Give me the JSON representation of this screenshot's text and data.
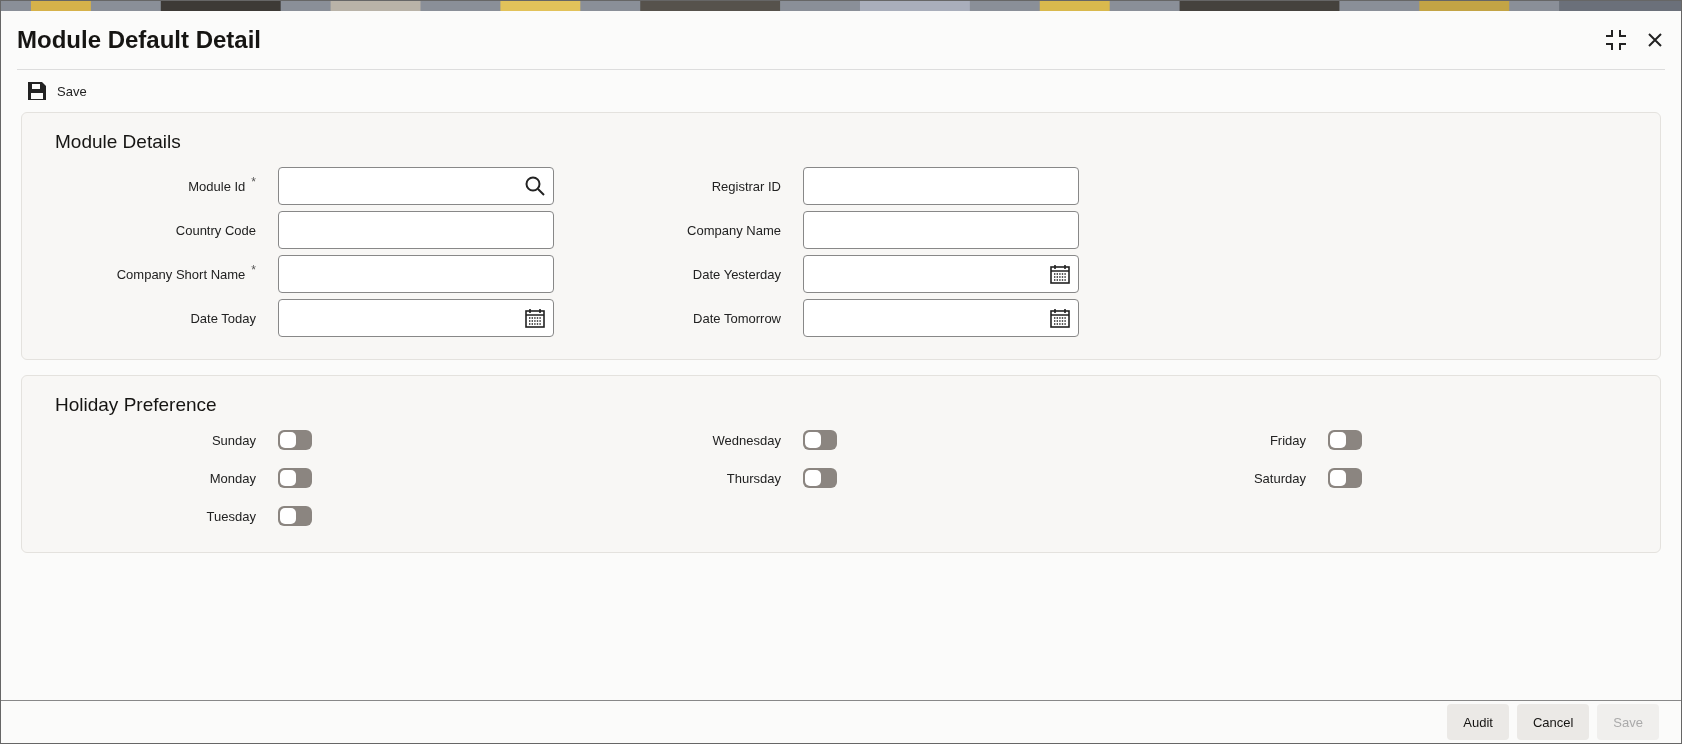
{
  "window": {
    "title": "Module Default Detail"
  },
  "toolbar": {
    "save_label": "Save"
  },
  "module_details": {
    "title": "Module Details",
    "columns": [
      [
        {
          "label": "Module Id",
          "kind": "lookup",
          "required_mark": "*"
        },
        {
          "label": "Country Code",
          "kind": "text"
        },
        {
          "label": "Company Short Name",
          "kind": "text",
          "required_mark": "*"
        },
        {
          "label": "Date Today",
          "kind": "date"
        }
      ],
      [
        {
          "label": "Registrar ID",
          "kind": "text"
        },
        {
          "label": "Company Name",
          "kind": "text"
        },
        {
          "label": "Date Yesterday",
          "kind": "date"
        },
        {
          "label": "Date Tomorrow",
          "kind": "date"
        }
      ]
    ]
  },
  "holiday_preference": {
    "title": "Holiday Preference",
    "columns": [
      [
        {
          "label": "Sunday",
          "on": false
        },
        {
          "label": "Monday",
          "on": false
        },
        {
          "label": "Tuesday",
          "on": false
        }
      ],
      [
        {
          "label": "Wednesday",
          "on": false
        },
        {
          "label": "Thursday",
          "on": false
        }
      ],
      [
        {
          "label": "Friday",
          "on": false
        },
        {
          "label": "Saturday",
          "on": false
        }
      ]
    ]
  },
  "footer_buttons": [
    {
      "label": "Audit",
      "disabled": false
    },
    {
      "label": "Cancel",
      "disabled": false
    },
    {
      "label": "Save",
      "disabled": true
    }
  ]
}
